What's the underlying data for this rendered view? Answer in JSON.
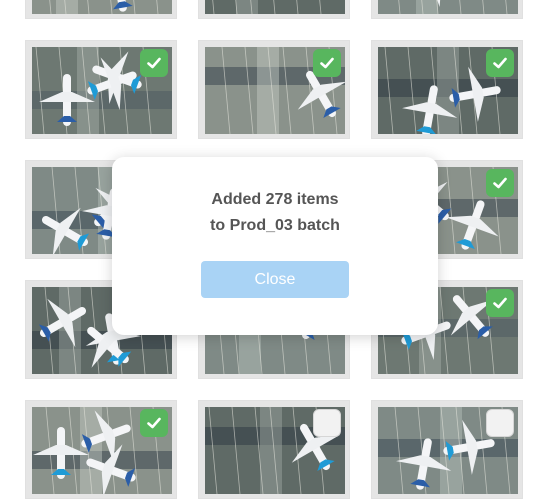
{
  "dialog": {
    "line1": "Added 278 items",
    "line2": "to Prod_03 batch",
    "close_label": "Close"
  },
  "tiles": [
    {
      "row": 0,
      "col": 0,
      "selected": true
    },
    {
      "row": 0,
      "col": 1,
      "selected": true
    },
    {
      "row": 0,
      "col": 2,
      "selected": true
    },
    {
      "row": 1,
      "col": 0,
      "selected": true
    },
    {
      "row": 1,
      "col": 1,
      "selected": true
    },
    {
      "row": 1,
      "col": 2,
      "selected": true
    },
    {
      "row": 2,
      "col": 0,
      "selected": true
    },
    {
      "row": 2,
      "col": 1,
      "selected": true
    },
    {
      "row": 2,
      "col": 2,
      "selected": true
    },
    {
      "row": 3,
      "col": 0,
      "selected": true
    },
    {
      "row": 3,
      "col": 1,
      "selected": true
    },
    {
      "row": 3,
      "col": 2,
      "selected": true
    },
    {
      "row": 4,
      "col": 0,
      "selected": true
    },
    {
      "row": 4,
      "col": 1,
      "selected": false
    },
    {
      "row": 4,
      "col": 2,
      "selected": false
    }
  ],
  "colors": {
    "check_on": "#58b65e",
    "close_button": "#a9d3f5"
  },
  "icons": {
    "check": "checkmark-icon"
  }
}
